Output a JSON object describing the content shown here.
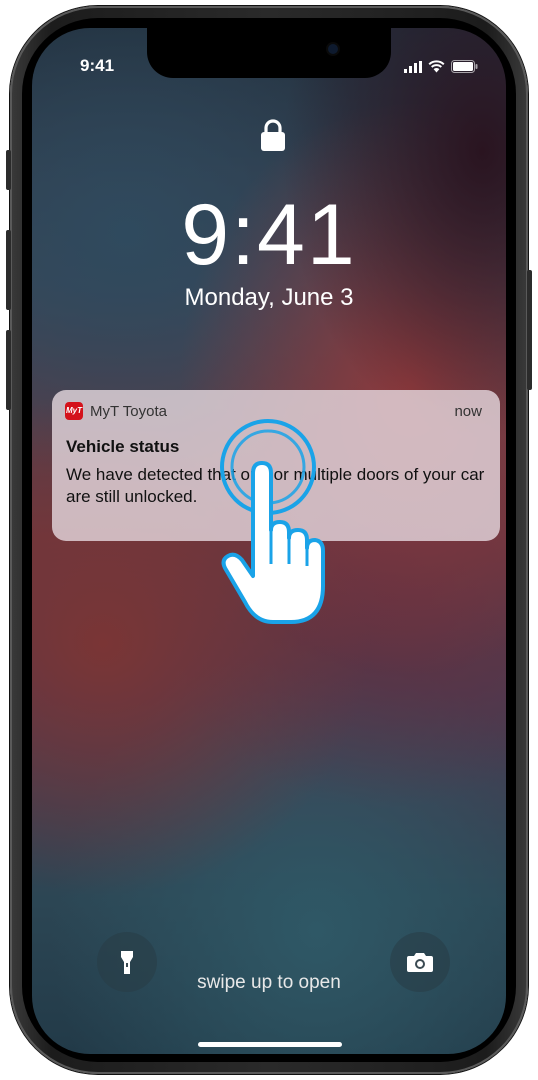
{
  "status_bar": {
    "time": "9:41"
  },
  "lock_screen": {
    "time": "9:41",
    "date": "Monday, June 3"
  },
  "notification": {
    "app_icon_text": "MyT",
    "app_name": "MyT Toyota",
    "time": "now",
    "title": "Vehicle status",
    "body": "We have detected that one or multiple doors of your car are still unlocked."
  },
  "footer": {
    "swipe_hint": "swipe up to open"
  },
  "icons": {
    "lock": "lock-icon",
    "flashlight": "flashlight-icon",
    "camera": "camera-icon",
    "signal": "signal-icon",
    "wifi": "wifi-icon",
    "battery": "battery-icon",
    "tap": "tap-hand-icon"
  },
  "colors": {
    "brand": "#d4121b",
    "tap_ring": "#1aa3e8"
  }
}
